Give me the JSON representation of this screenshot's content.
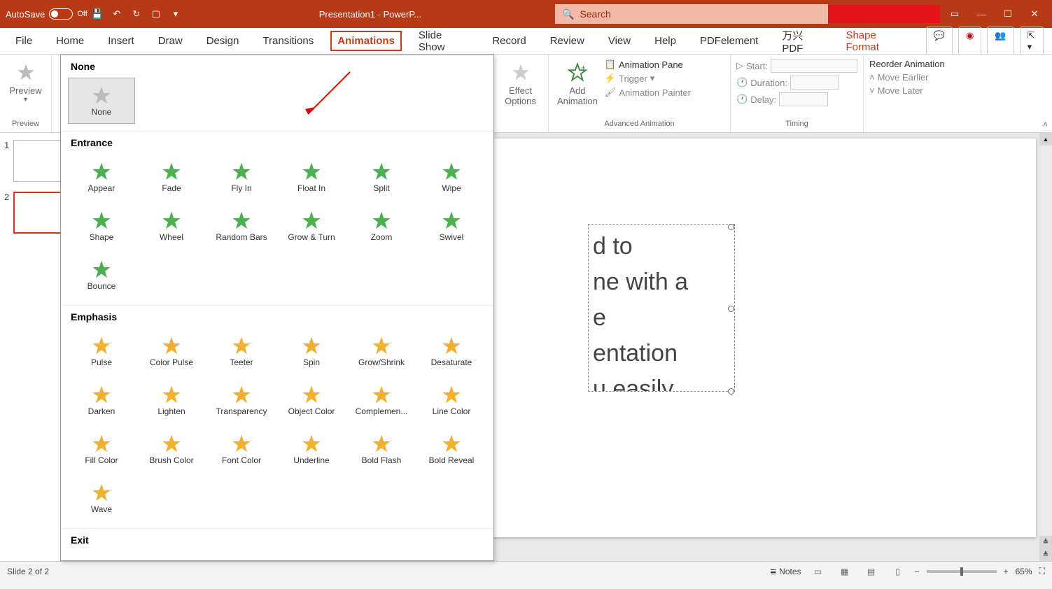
{
  "titlebar": {
    "autosave": "AutoSave",
    "autosave_state": "Off",
    "title": "Presentation1 - PowerP...",
    "search_placeholder": "Search"
  },
  "tabs": {
    "file": "File",
    "home": "Home",
    "insert": "Insert",
    "draw": "Draw",
    "design": "Design",
    "transitions": "Transitions",
    "animations": "Animations",
    "slideshow": "Slide Show",
    "record": "Record",
    "review": "Review",
    "view": "View",
    "help": "Help",
    "pdfelement": "PDFelement",
    "wanxing": "万兴PDF",
    "shape_format": "Shape Format"
  },
  "ribbon": {
    "preview": "Preview",
    "preview_group": "Preview",
    "effect_options": "Effect\nOptions",
    "add_animation": "Add\nAnimation",
    "animation_pane": "Animation Pane",
    "trigger": "Trigger",
    "animation_painter": "Animation Painter",
    "advanced_group": "Advanced Animation",
    "start": "Start:",
    "duration": "Duration:",
    "delay": "Delay:",
    "timing_group": "Timing",
    "reorder": "Reorder Animation",
    "move_earlier": "Move Earlier",
    "move_later": "Move Later"
  },
  "gallery": {
    "section_none": "None",
    "none": "None",
    "section_entrance": "Entrance",
    "entrance": [
      "Appear",
      "Fade",
      "Fly In",
      "Float In",
      "Split",
      "Wipe",
      "Shape",
      "Wheel",
      "Random Bars",
      "Grow & Turn",
      "Zoom",
      "Swivel",
      "Bounce"
    ],
    "section_emphasis": "Emphasis",
    "emphasis": [
      "Pulse",
      "Color Pulse",
      "Teeter",
      "Spin",
      "Grow/Shrink",
      "Desaturate",
      "Darken",
      "Lighten",
      "Transparency",
      "Object Color",
      "Complemen...",
      "Line Color",
      "Fill Color",
      "Brush Color",
      "Font Color",
      "Underline",
      "Bold Flash",
      "Bold Reveal",
      "Wave"
    ],
    "section_exit": "Exit"
  },
  "slides": {
    "num1": "1",
    "num2": "2"
  },
  "canvas_text": "d to\nne with a\ne\nentation\nu easily\ne ideas.",
  "status": {
    "slide_info": "Slide 2 of 2",
    "notes": "Notes",
    "zoom": "65%"
  }
}
